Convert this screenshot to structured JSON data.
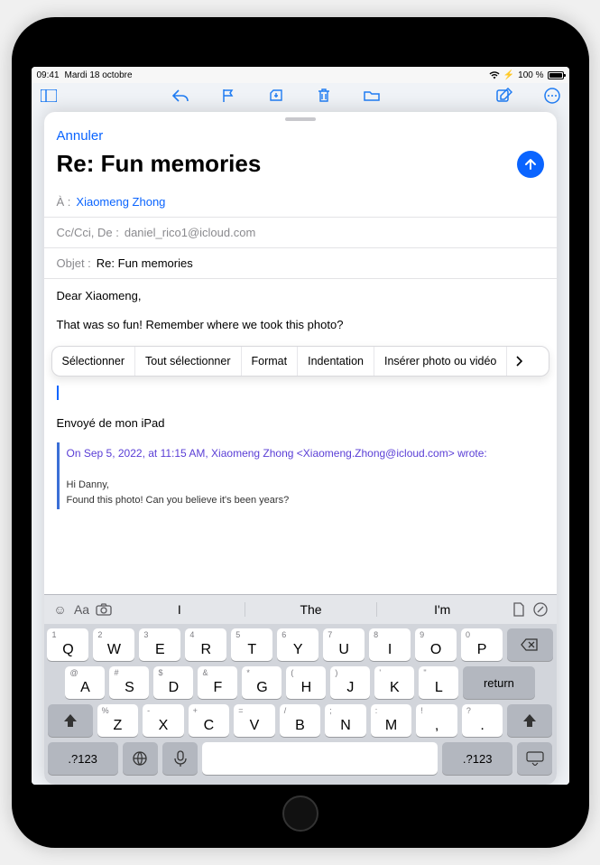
{
  "status": {
    "time": "09:41",
    "day": "Mardi 18 octobre",
    "battery_pct": "100 %",
    "charging_icon": "charging"
  },
  "mail_bg_toolbar": {
    "icons": [
      "sidebar",
      "back",
      "reply",
      "forward",
      "move",
      "trash",
      "folder",
      "compose",
      "more"
    ]
  },
  "compose": {
    "cancel": "Annuler",
    "title": "Re: Fun memories",
    "send_icon": "arrow-up",
    "fields": {
      "to_label": "À :",
      "to_value": "Xiaomeng Zhong",
      "cc_label": "Cc/Cci, De :",
      "cc_value": "daniel_rico1@icloud.com",
      "subject_label": "Objet :",
      "subject_value": "Re: Fun memories"
    },
    "body": {
      "greeting": "Dear Xiaomeng,",
      "line1": "That was so fun! Remember where we took this photo?",
      "signature": "Envoyé de mon iPad"
    },
    "edit_menu": {
      "items": [
        "Sélectionner",
        "Tout sélectionner",
        "Format",
        "Indentation",
        "Insérer photo ou vidéo"
      ],
      "more": "›"
    },
    "quote": {
      "header": "On Sep 5, 2022, at 11:15 AM, Xiaomeng Zhong <Xiaomeng.Zhong@icloud.com> wrote:",
      "body1": "Hi Danny,",
      "body2": "Found this photo! Can you believe it's been years?"
    }
  },
  "keyboard": {
    "suggestions": [
      "I",
      "The",
      "I'm"
    ],
    "row1": [
      {
        "main": "Q",
        "alt": "1"
      },
      {
        "main": "W",
        "alt": "2"
      },
      {
        "main": "E",
        "alt": "3"
      },
      {
        "main": "R",
        "alt": "4"
      },
      {
        "main": "T",
        "alt": "5"
      },
      {
        "main": "Y",
        "alt": "6"
      },
      {
        "main": "U",
        "alt": "7"
      },
      {
        "main": "I",
        "alt": "8"
      },
      {
        "main": "O",
        "alt": "9"
      },
      {
        "main": "P",
        "alt": "0"
      }
    ],
    "row2": [
      {
        "main": "A",
        "alt": "@"
      },
      {
        "main": "S",
        "alt": "#"
      },
      {
        "main": "D",
        "alt": "$"
      },
      {
        "main": "F",
        "alt": "&"
      },
      {
        "main": "G",
        "alt": "*"
      },
      {
        "main": "H",
        "alt": "("
      },
      {
        "main": "J",
        "alt": ")"
      },
      {
        "main": "K",
        "alt": "'"
      },
      {
        "main": "L",
        "alt": "\""
      }
    ],
    "row3": [
      {
        "main": "Z",
        "alt": "%"
      },
      {
        "main": "X",
        "alt": "-"
      },
      {
        "main": "C",
        "alt": "+"
      },
      {
        "main": "V",
        "alt": "="
      },
      {
        "main": "B",
        "alt": "/"
      },
      {
        "main": "N",
        "alt": ";"
      },
      {
        "main": "M",
        "alt": ":"
      },
      {
        "main": ",",
        "alt": "!"
      },
      {
        "main": ".",
        "alt": "?"
      }
    ],
    "return_label": "return",
    "numkey": ".?123"
  }
}
